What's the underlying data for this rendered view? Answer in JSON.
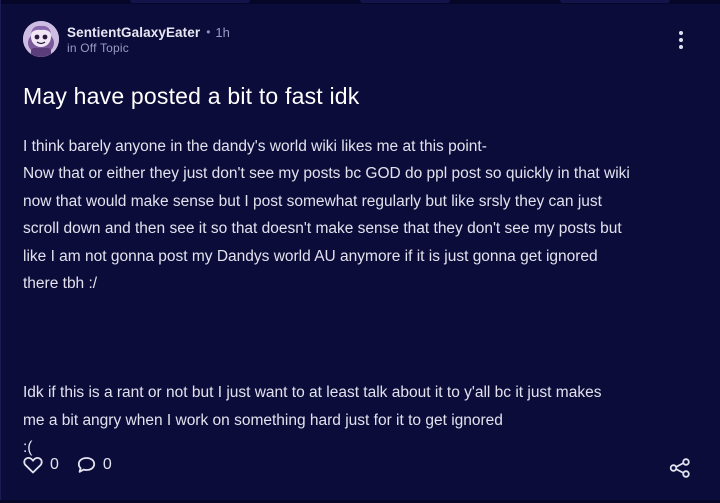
{
  "post": {
    "author": "SentientGalaxyEater",
    "separator": "•",
    "time": "1h",
    "category": "in Off Topic",
    "title": "May have posted a bit to fast idk",
    "paragraphs": [
      "I think barely anyone in the dandy's world wiki likes me at this point-",
      "Now that or either they just don't see my posts bc GOD do ppl post so quickly in that wiki",
      "now that would make sense but I post somewhat regularly but like srsly they can just",
      "scroll down and then see it so that doesn't make sense that they don't see my posts but",
      "like I am not gonna post my Dandys world AU anymore if it is just gonna get ignored",
      "there tbh :/"
    ],
    "paragraphs2": [
      "Idk if this is a rant or not but I just want to at least talk about it to y'all bc it just makes",
      "me a bit angry when I work on something hard just for it to get ignored",
      ":("
    ],
    "likes": "0",
    "comments": "0"
  },
  "icons": {
    "more": "more-vertical-icon",
    "like": "heart-icon",
    "comment": "comment-bubble-icon",
    "share": "share-icon"
  },
  "colors": {
    "background": "#0c0c3a",
    "text": "#e2e2ee",
    "muted": "#9a9ac2"
  }
}
